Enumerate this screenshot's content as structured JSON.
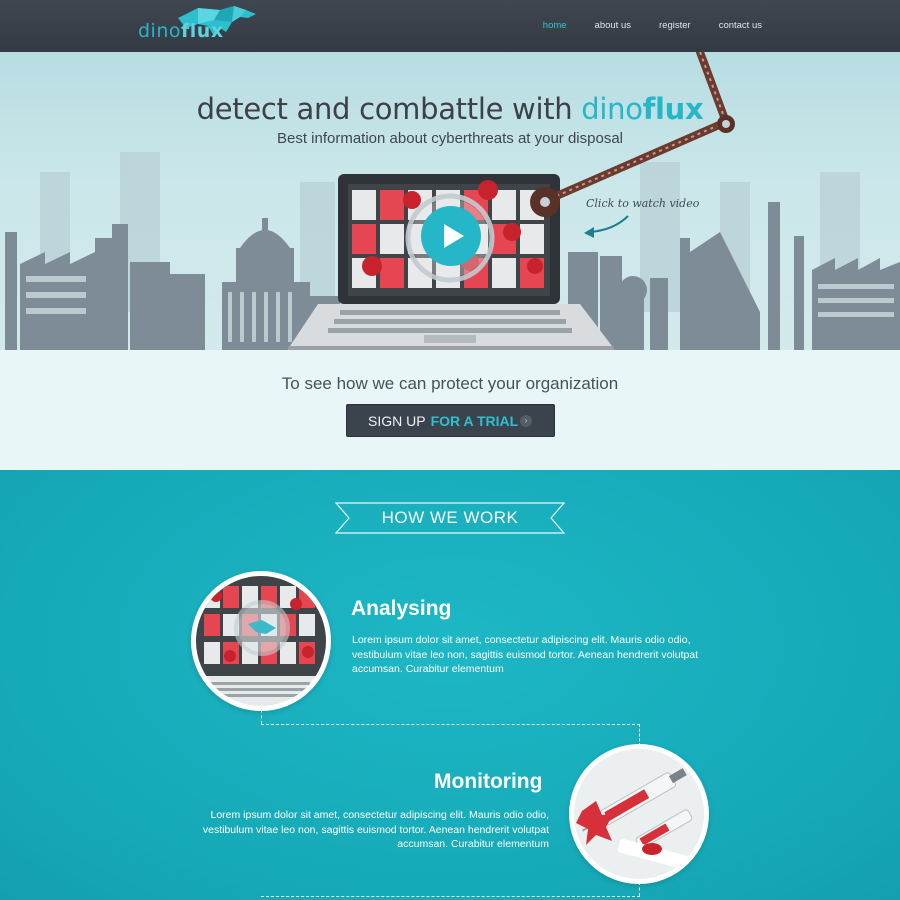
{
  "brand": {
    "logo_part1": "dino",
    "logo_part2": "flux"
  },
  "nav": {
    "items": [
      {
        "label": "home",
        "active": true
      },
      {
        "label": "about us",
        "active": false
      },
      {
        "label": "register",
        "active": false
      },
      {
        "label": "contact us",
        "active": false
      }
    ]
  },
  "hero": {
    "headline": "detect and combattle with ",
    "headline_brand_1": "dino",
    "headline_brand_2": "flux",
    "subheadline": "Best information about cyberthreats at your disposal",
    "watch_video": "Click to watch video"
  },
  "cta": {
    "text": "To see how we can protect your organization",
    "button_main": "SIGN UP",
    "button_accent": "FOR A TRIAL"
  },
  "how_we_work": {
    "title": "HOW WE WORK",
    "steps": [
      {
        "title": "Analysing",
        "body": "Lorem ipsum dolor sit amet, consectetur adipiscing elit. Mauris odio odio, vestibulum vitae leo non, sagittis euismod tortor. Aenean hendrerit volutpat accumsan. Curabitur elementum"
      },
      {
        "title": "Monitoring",
        "body": "Lorem ipsum dolor sit amet, consectetur adipiscing elit. Mauris odio odio, vestibulum vitae leo non, sagittis euismod tortor. Aenean hendrerit volutpat accumsan. Curabitur elementum"
      }
    ]
  },
  "colors": {
    "accent": "#25b7c8",
    "nav_bg": "#3a414a",
    "teal_bg": "#17abb9",
    "hero_bg": "#c6e4e8",
    "threat_red": "#d6303a"
  }
}
